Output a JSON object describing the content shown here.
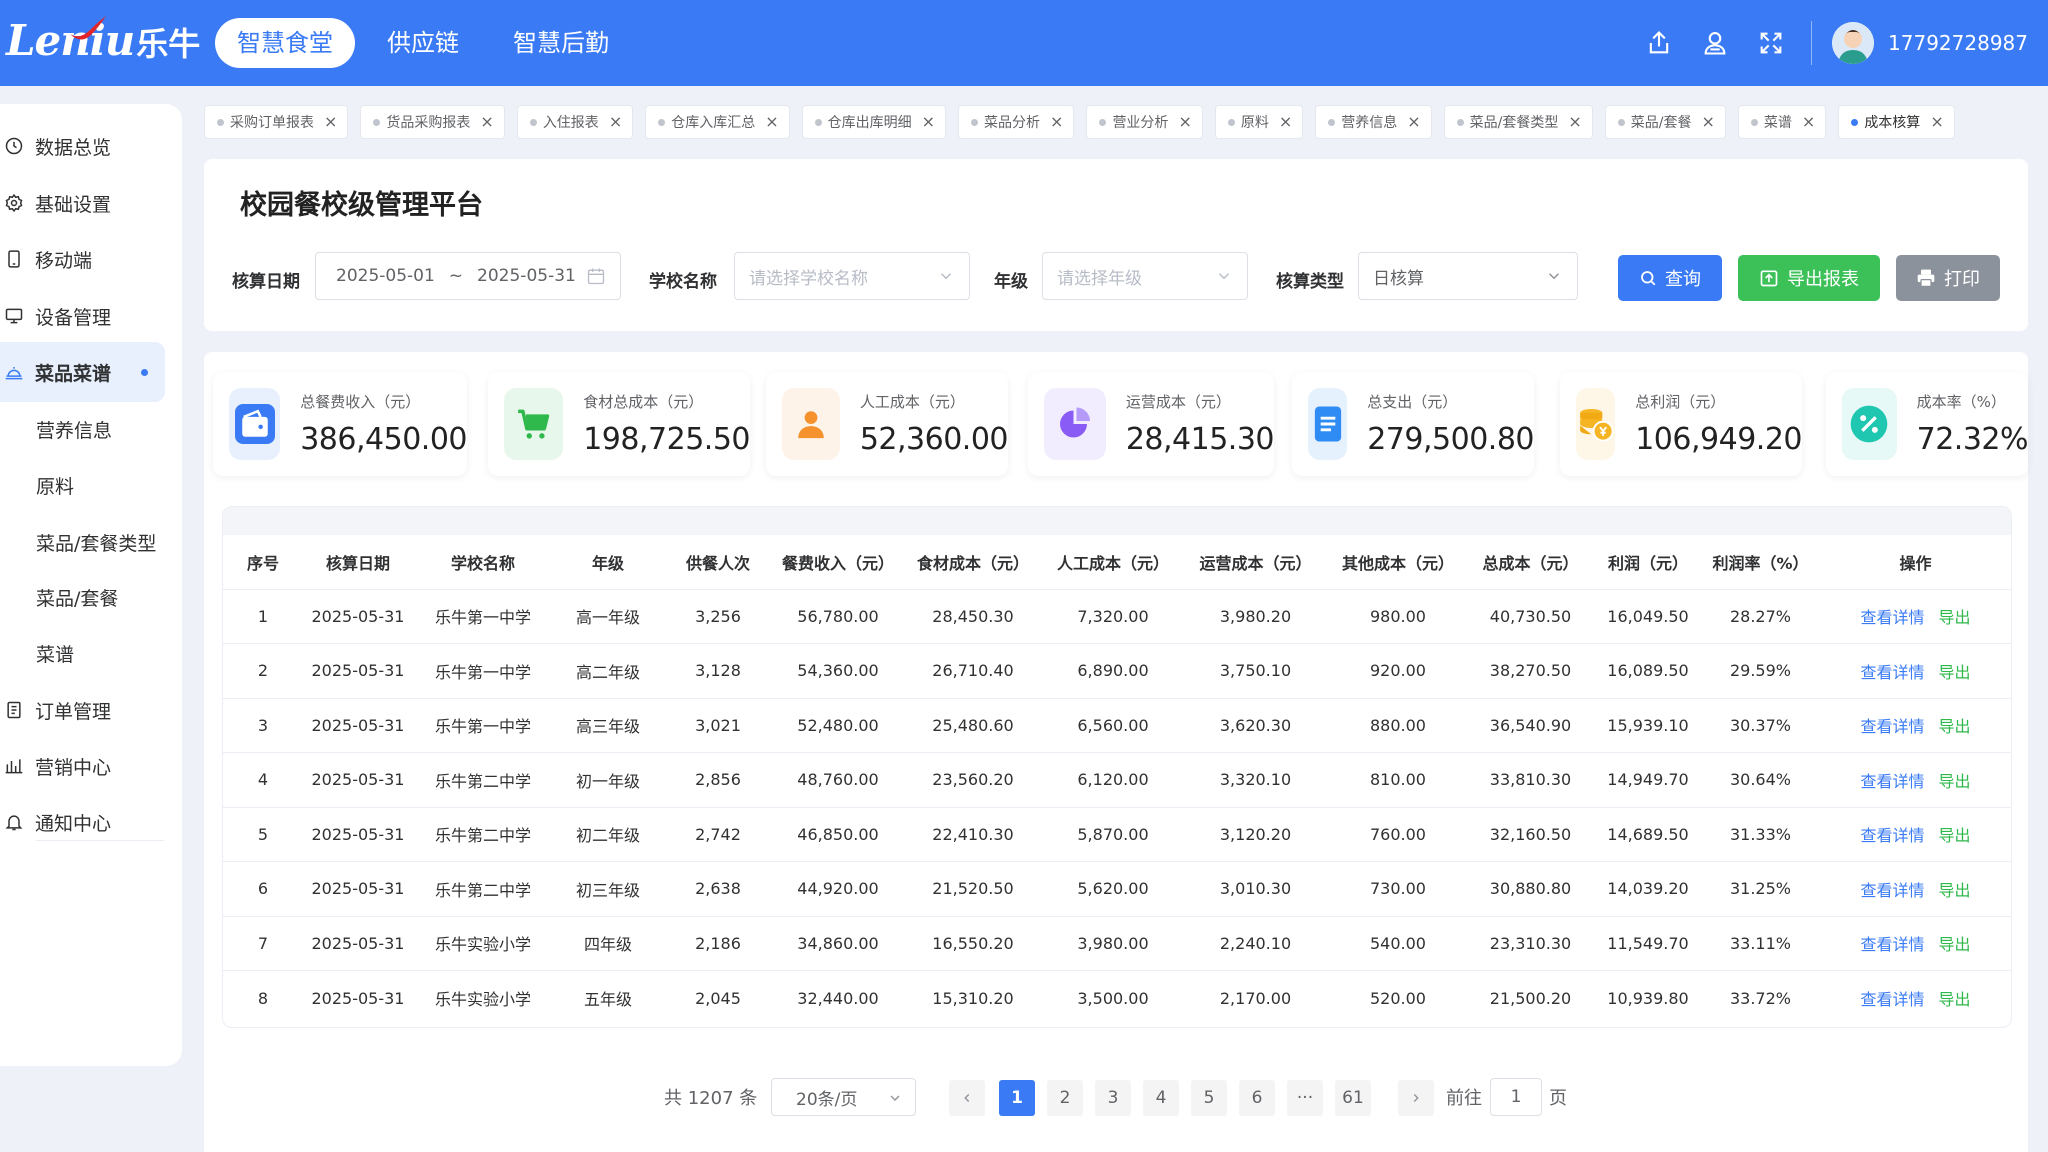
{
  "brand": {
    "logo_en": "Leniu",
    "logo_cn": "乐牛"
  },
  "topnav": [
    {
      "label": "智慧食堂",
      "active": true
    },
    {
      "label": "供应链",
      "active": false
    },
    {
      "label": "智慧后勤",
      "active": false
    }
  ],
  "header": {
    "username": "17792728987",
    "tools": [
      "share-icon",
      "user-icon",
      "fullscreen-icon"
    ]
  },
  "sidebar": {
    "items": [
      {
        "label": "数据总览",
        "icon": "clock-icon"
      },
      {
        "label": "基础设置",
        "icon": "gear-icon"
      },
      {
        "label": "移动端",
        "icon": "mobile-icon"
      },
      {
        "label": "设备管理",
        "icon": "monitor-icon"
      },
      {
        "label": "菜品菜谱",
        "icon": "dish-icon",
        "active": true
      },
      {
        "label": "营养信息",
        "sub": true
      },
      {
        "label": "原料",
        "sub": true
      },
      {
        "label": "菜品/套餐类型",
        "sub": true
      },
      {
        "label": "菜品/套餐",
        "sub": true
      },
      {
        "label": "菜谱",
        "sub": true
      },
      {
        "label": "订单管理",
        "icon": "order-icon"
      },
      {
        "label": "营销中心",
        "icon": "chart-icon"
      },
      {
        "label": "通知中心",
        "icon": "bell-icon"
      }
    ]
  },
  "tabs": [
    {
      "label": "采购订单报表"
    },
    {
      "label": "货品采购报表"
    },
    {
      "label": "入住报表"
    },
    {
      "label": "仓库入库汇总"
    },
    {
      "label": "仓库出库明细"
    },
    {
      "label": "菜品分析"
    },
    {
      "label": "营业分析"
    },
    {
      "label": "原料"
    },
    {
      "label": "营养信息"
    },
    {
      "label": "菜品/套餐类型"
    },
    {
      "label": "菜品/套餐"
    },
    {
      "label": "菜谱"
    },
    {
      "label": "成本核算",
      "active": true
    }
  ],
  "page": {
    "title": "校园餐校级管理平台"
  },
  "filters": {
    "date_label": "核算日期",
    "date_start": "2025-05-01",
    "date_sep": "~",
    "date_end": "2025-05-31",
    "school_label": "学校名称",
    "school_placeholder": "请选择学校名称",
    "grade_label": "年级",
    "grade_placeholder": "请选择年级",
    "type_label": "核算类型",
    "type_value": "日核算"
  },
  "buttons": {
    "query": "查询",
    "export": "导出报表",
    "print": "打印"
  },
  "stats": [
    {
      "label": "总餐费收入（元）",
      "value": "386,450.00",
      "icon": "wallet-icon",
      "color": "#3a7bf5"
    },
    {
      "label": "食材总成本（元）",
      "value": "198,725.50",
      "icon": "cart-icon",
      "color": "#2fb84b"
    },
    {
      "label": "人工成本（元）",
      "value": "52,360.00",
      "icon": "person-icon",
      "color": "#f5922e"
    },
    {
      "label": "运营成本（元）",
      "value": "28,415.30",
      "icon": "pie-icon",
      "color": "#8a5cf6"
    },
    {
      "label": "总支出（元）",
      "value": "279,500.80",
      "icon": "document-icon",
      "color": "#2f8cf5"
    },
    {
      "label": "总利润（元）",
      "value": "106,949.20",
      "icon": "coins-icon",
      "color": "#f5b524"
    },
    {
      "label": "成本率（%）",
      "value": "72.32%",
      "icon": "percent-icon",
      "color": "#1fc7b0"
    }
  ],
  "table": {
    "columns": [
      "序号",
      "核算日期",
      "学校名称",
      "年级",
      "供餐人次",
      "餐费收入（元）",
      "食材成本（元）",
      "人工成本（元）",
      "运营成本（元）",
      "其他成本（元）",
      "总成本（元）",
      "利润（元）",
      "利润率（%）",
      "操作"
    ],
    "rows": [
      [
        "1",
        "2025-05-31",
        "乐牛第一中学",
        "高一年级",
        "3,256",
        "56,780.00",
        "28,450.30",
        "7,320.00",
        "3,980.20",
        "980.00",
        "40,730.50",
        "16,049.50",
        "28.27%"
      ],
      [
        "2",
        "2025-05-31",
        "乐牛第一中学",
        "高二年级",
        "3,128",
        "54,360.00",
        "26,710.40",
        "6,890.00",
        "3,750.10",
        "920.00",
        "38,270.50",
        "16,089.50",
        "29.59%"
      ],
      [
        "3",
        "2025-05-31",
        "乐牛第一中学",
        "高三年级",
        "3,021",
        "52,480.00",
        "25,480.60",
        "6,560.00",
        "3,620.30",
        "880.00",
        "36,540.90",
        "15,939.10",
        "30.37%"
      ],
      [
        "4",
        "2025-05-31",
        "乐牛第二中学",
        "初一年级",
        "2,856",
        "48,760.00",
        "23,560.20",
        "6,120.00",
        "3,320.10",
        "810.00",
        "33,810.30",
        "14,949.70",
        "30.64%"
      ],
      [
        "5",
        "2025-05-31",
        "乐牛第二中学",
        "初二年级",
        "2,742",
        "46,850.00",
        "22,410.30",
        "5,870.00",
        "3,120.20",
        "760.00",
        "32,160.50",
        "14,689.50",
        "31.33%"
      ],
      [
        "6",
        "2025-05-31",
        "乐牛第二中学",
        "初三年级",
        "2,638",
        "44,920.00",
        "21,520.50",
        "5,620.00",
        "3,010.30",
        "730.00",
        "30,880.80",
        "14,039.20",
        "31.25%"
      ],
      [
        "7",
        "2025-05-31",
        "乐牛实验小学",
        "四年级",
        "2,186",
        "34,860.00",
        "16,550.20",
        "3,980.00",
        "2,240.10",
        "540.00",
        "23,310.30",
        "11,549.70",
        "33.11%"
      ],
      [
        "8",
        "2025-05-31",
        "乐牛实验小学",
        "五年级",
        "2,045",
        "32,440.00",
        "15,310.20",
        "3,500.00",
        "2,170.00",
        "520.00",
        "21,500.20",
        "10,939.80",
        "33.72%"
      ]
    ],
    "action_detail": "查看详情",
    "action_export": "导出"
  },
  "pagination": {
    "total": "共 1207 条",
    "page_size": "20条/页",
    "pages": [
      "1",
      "2",
      "3",
      "4",
      "5",
      "6",
      "···",
      "61"
    ],
    "current": "1",
    "goto_label": "前往",
    "goto_value": "1",
    "goto_unit": "页"
  }
}
